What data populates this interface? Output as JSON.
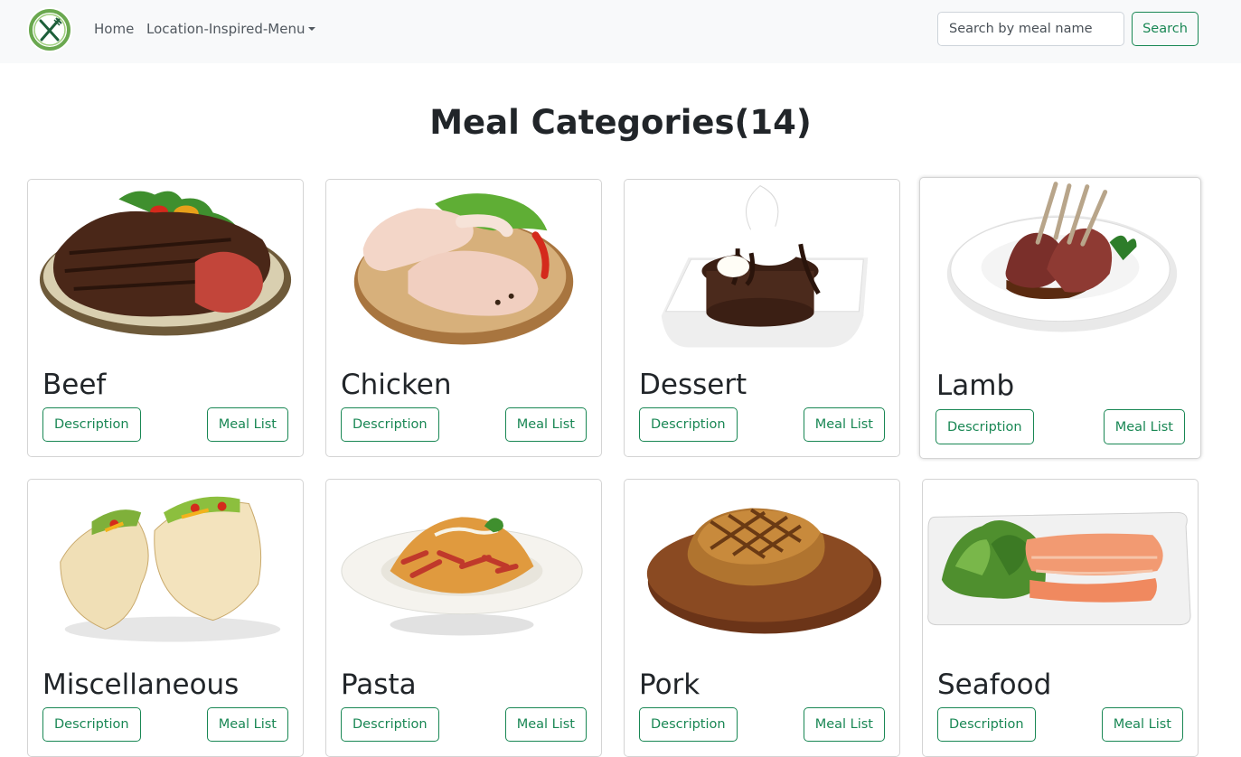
{
  "navbar": {
    "logo_icon": "fork-knife-icon",
    "links": [
      "Home",
      "Location-Inspired-Menu"
    ],
    "search": {
      "placeholder": "Search by meal name",
      "value": "",
      "button_label": "Search"
    },
    "colors": {
      "accent": "#198754",
      "background": "#f8f9fa"
    }
  },
  "main": {
    "title": "Meal Categories(14)",
    "cards": [
      {
        "name": "Beef",
        "image": "steak-plate",
        "description_label": "Description",
        "meal_list_label": "Meal List"
      },
      {
        "name": "Chicken",
        "image": "raw-chicken-board",
        "description_label": "Description",
        "meal_list_label": "Meal List"
      },
      {
        "name": "Dessert",
        "image": "chocolate-cake",
        "description_label": "Description",
        "meal_list_label": "Meal List"
      },
      {
        "name": "Lamb",
        "image": "lamb-chops",
        "description_label": "Description",
        "meal_list_label": "Meal List"
      },
      {
        "name": "Miscellaneous",
        "image": "tacos",
        "description_label": "Description",
        "meal_list_label": "Meal List"
      },
      {
        "name": "Pasta",
        "image": "penne-bowl",
        "description_label": "Description",
        "meal_list_label": "Meal List"
      },
      {
        "name": "Pork",
        "image": "pork-chop-board",
        "description_label": "Description",
        "meal_list_label": "Meal List"
      },
      {
        "name": "Seafood",
        "image": "salmon-platter",
        "description_label": "Description",
        "meal_list_label": "Meal List"
      }
    ]
  }
}
